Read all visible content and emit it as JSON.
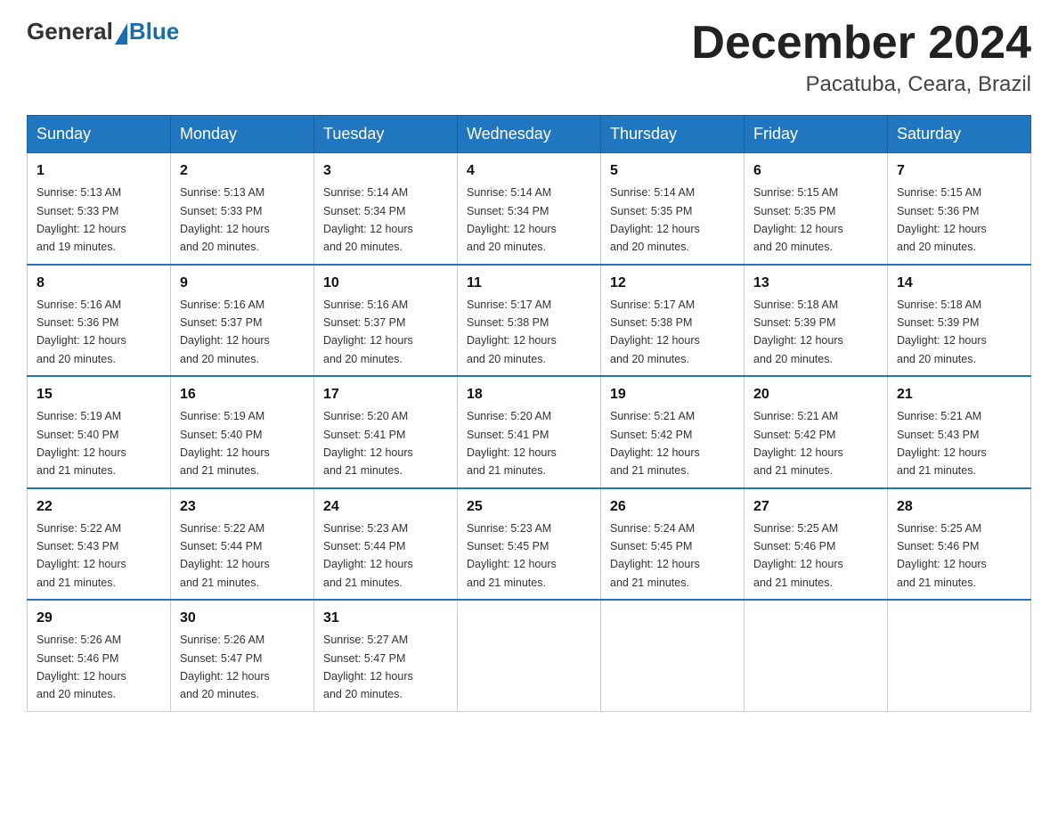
{
  "header": {
    "logo_general": "General",
    "logo_blue": "Blue",
    "month_title": "December 2024",
    "location": "Pacatuba, Ceara, Brazil"
  },
  "days_of_week": [
    "Sunday",
    "Monday",
    "Tuesday",
    "Wednesday",
    "Thursday",
    "Friday",
    "Saturday"
  ],
  "weeks": [
    [
      {
        "day": "1",
        "sunrise": "5:13 AM",
        "sunset": "5:33 PM",
        "daylight": "12 hours and 19 minutes."
      },
      {
        "day": "2",
        "sunrise": "5:13 AM",
        "sunset": "5:33 PM",
        "daylight": "12 hours and 20 minutes."
      },
      {
        "day": "3",
        "sunrise": "5:14 AM",
        "sunset": "5:34 PM",
        "daylight": "12 hours and 20 minutes."
      },
      {
        "day": "4",
        "sunrise": "5:14 AM",
        "sunset": "5:34 PM",
        "daylight": "12 hours and 20 minutes."
      },
      {
        "day": "5",
        "sunrise": "5:14 AM",
        "sunset": "5:35 PM",
        "daylight": "12 hours and 20 minutes."
      },
      {
        "day": "6",
        "sunrise": "5:15 AM",
        "sunset": "5:35 PM",
        "daylight": "12 hours and 20 minutes."
      },
      {
        "day": "7",
        "sunrise": "5:15 AM",
        "sunset": "5:36 PM",
        "daylight": "12 hours and 20 minutes."
      }
    ],
    [
      {
        "day": "8",
        "sunrise": "5:16 AM",
        "sunset": "5:36 PM",
        "daylight": "12 hours and 20 minutes."
      },
      {
        "day": "9",
        "sunrise": "5:16 AM",
        "sunset": "5:37 PM",
        "daylight": "12 hours and 20 minutes."
      },
      {
        "day": "10",
        "sunrise": "5:16 AM",
        "sunset": "5:37 PM",
        "daylight": "12 hours and 20 minutes."
      },
      {
        "day": "11",
        "sunrise": "5:17 AM",
        "sunset": "5:38 PM",
        "daylight": "12 hours and 20 minutes."
      },
      {
        "day": "12",
        "sunrise": "5:17 AM",
        "sunset": "5:38 PM",
        "daylight": "12 hours and 20 minutes."
      },
      {
        "day": "13",
        "sunrise": "5:18 AM",
        "sunset": "5:39 PM",
        "daylight": "12 hours and 20 minutes."
      },
      {
        "day": "14",
        "sunrise": "5:18 AM",
        "sunset": "5:39 PM",
        "daylight": "12 hours and 20 minutes."
      }
    ],
    [
      {
        "day": "15",
        "sunrise": "5:19 AM",
        "sunset": "5:40 PM",
        "daylight": "12 hours and 21 minutes."
      },
      {
        "day": "16",
        "sunrise": "5:19 AM",
        "sunset": "5:40 PM",
        "daylight": "12 hours and 21 minutes."
      },
      {
        "day": "17",
        "sunrise": "5:20 AM",
        "sunset": "5:41 PM",
        "daylight": "12 hours and 21 minutes."
      },
      {
        "day": "18",
        "sunrise": "5:20 AM",
        "sunset": "5:41 PM",
        "daylight": "12 hours and 21 minutes."
      },
      {
        "day": "19",
        "sunrise": "5:21 AM",
        "sunset": "5:42 PM",
        "daylight": "12 hours and 21 minutes."
      },
      {
        "day": "20",
        "sunrise": "5:21 AM",
        "sunset": "5:42 PM",
        "daylight": "12 hours and 21 minutes."
      },
      {
        "day": "21",
        "sunrise": "5:21 AM",
        "sunset": "5:43 PM",
        "daylight": "12 hours and 21 minutes."
      }
    ],
    [
      {
        "day": "22",
        "sunrise": "5:22 AM",
        "sunset": "5:43 PM",
        "daylight": "12 hours and 21 minutes."
      },
      {
        "day": "23",
        "sunrise": "5:22 AM",
        "sunset": "5:44 PM",
        "daylight": "12 hours and 21 minutes."
      },
      {
        "day": "24",
        "sunrise": "5:23 AM",
        "sunset": "5:44 PM",
        "daylight": "12 hours and 21 minutes."
      },
      {
        "day": "25",
        "sunrise": "5:23 AM",
        "sunset": "5:45 PM",
        "daylight": "12 hours and 21 minutes."
      },
      {
        "day": "26",
        "sunrise": "5:24 AM",
        "sunset": "5:45 PM",
        "daylight": "12 hours and 21 minutes."
      },
      {
        "day": "27",
        "sunrise": "5:25 AM",
        "sunset": "5:46 PM",
        "daylight": "12 hours and 21 minutes."
      },
      {
        "day": "28",
        "sunrise": "5:25 AM",
        "sunset": "5:46 PM",
        "daylight": "12 hours and 21 minutes."
      }
    ],
    [
      {
        "day": "29",
        "sunrise": "5:26 AM",
        "sunset": "5:46 PM",
        "daylight": "12 hours and 20 minutes."
      },
      {
        "day": "30",
        "sunrise": "5:26 AM",
        "sunset": "5:47 PM",
        "daylight": "12 hours and 20 minutes."
      },
      {
        "day": "31",
        "sunrise": "5:27 AM",
        "sunset": "5:47 PM",
        "daylight": "12 hours and 20 minutes."
      },
      null,
      null,
      null,
      null
    ]
  ],
  "labels": {
    "sunrise": "Sunrise:",
    "sunset": "Sunset:",
    "daylight": "Daylight:"
  }
}
